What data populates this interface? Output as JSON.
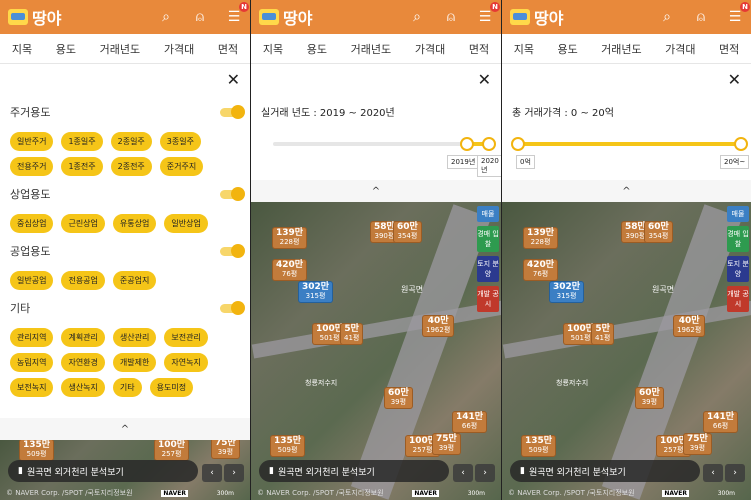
{
  "app": {
    "title": "땅야"
  },
  "filter_tabs": [
    "지목",
    "용도",
    "거래년도",
    "가격대",
    "면적"
  ],
  "appbar_icons": [
    "search-icon",
    "user-icon",
    "menu-icon"
  ],
  "notification_badge": "N",
  "use_drawer": {
    "sections": [
      {
        "title": "주거용도",
        "enabled": true,
        "chips": [
          "일반주거",
          "1종일주",
          "2종일주",
          "3종일주",
          "전용주거",
          "1종전주",
          "2종전주",
          "준거주지"
        ]
      },
      {
        "title": "상업용도",
        "enabled": true,
        "chips": [
          "중심상업",
          "근린상업",
          "유통상업",
          "일반상업"
        ]
      },
      {
        "title": "공업용도",
        "enabled": true,
        "chips": [
          "일반공업",
          "전용공업",
          "준공업지"
        ]
      },
      {
        "title": "기타",
        "enabled": true,
        "chips": [
          "관리지역",
          "계획관리",
          "생산관리",
          "보전관리",
          "농림지역",
          "자연환경",
          "개발제한",
          "자연녹지",
          "보전녹지",
          "생산녹지",
          "기타",
          "용도미정"
        ]
      }
    ]
  },
  "year_drawer": {
    "title": "실거래 년도 : 2019 ~ 2020년",
    "min_label": "2019년",
    "max_label": "2020년",
    "range": [
      0.9,
      1.0
    ]
  },
  "price_drawer": {
    "title": "총 거래가격 : 0 ~ 20억",
    "min_label": "0억",
    "max_label": "20억~",
    "range": [
      0.0,
      1.0
    ]
  },
  "map": {
    "markers": [
      {
        "price": "139만",
        "area": "228평"
      },
      {
        "price": "58만",
        "area": "390평"
      },
      {
        "price": "60만",
        "area": "354평"
      },
      {
        "price": "420만",
        "area": "76평"
      },
      {
        "price": "302만",
        "area": "315평",
        "blue": true
      },
      {
        "price": "100만",
        "area": "501평"
      },
      {
        "price": "5만",
        "area": "41평"
      },
      {
        "price": "40만",
        "area": "1962평"
      },
      {
        "price": "60만",
        "area": "39평"
      },
      {
        "price": "141만",
        "area": "66평"
      },
      {
        "price": "135만",
        "area": "509평"
      },
      {
        "price": "100만",
        "area": "257평"
      },
      {
        "price": "75만",
        "area": "39평"
      }
    ],
    "side_tags": [
      {
        "label": "매물",
        "color": "#3b7fc4"
      },
      {
        "label": "경매 입찰",
        "color": "#2e9b4f"
      },
      {
        "label": "토지 분양",
        "color": "#2b3a8f"
      },
      {
        "label": "개발 공시",
        "color": "#c0392b"
      }
    ],
    "place_labels": [
      "원곡면",
      "청룡저수지"
    ],
    "analysis_button": "원곡면 외거천리 분석보기",
    "pager_prev": "‹",
    "pager_next": "›",
    "credit": "© NAVER Corp. /SPOT /국토지리정보원",
    "naver": "NAVER",
    "scale": "300m"
  },
  "collapse_label": "^",
  "close_label": "✕"
}
